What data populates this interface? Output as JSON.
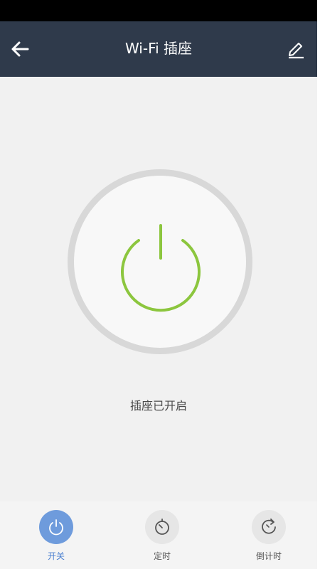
{
  "header": {
    "title": "Wi-Fi 插座",
    "back_icon": "back-arrow-icon",
    "edit_icon": "pencil-icon",
    "background": "#2f3a4b"
  },
  "power": {
    "icon": "power-icon",
    "state": "on",
    "color": "#8cc63e",
    "status_text": "插座已开启"
  },
  "bottom_nav": {
    "items": [
      {
        "label": "开关",
        "icon": "power-icon",
        "active": true
      },
      {
        "label": "定时",
        "icon": "timer-icon",
        "active": false
      },
      {
        "label": "倒计时",
        "icon": "countdown-icon",
        "active": false
      }
    ],
    "active_color": "#6e9bdc"
  }
}
